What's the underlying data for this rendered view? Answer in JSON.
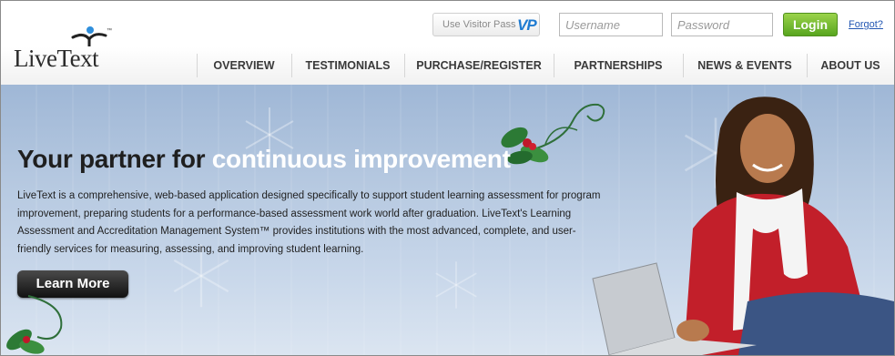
{
  "header": {
    "logo_text": "LiveText",
    "logo_tm": "™",
    "visitor_pass_label": "Use Visitor Pass",
    "visitor_pass_icon": "VP",
    "username_placeholder": "Username",
    "password_placeholder": "Password",
    "login_label": "Login",
    "forgot_label": "Forgot?"
  },
  "nav": {
    "items": [
      {
        "label": "OVERVIEW"
      },
      {
        "label": "TESTIMONIALS"
      },
      {
        "label": "PURCHASE/REGISTER"
      },
      {
        "label": "PARTNERSHIPS"
      },
      {
        "label": "NEWS & EVENTS"
      },
      {
        "label": "ABOUT US"
      }
    ]
  },
  "hero": {
    "headline_dark": "Your partner for",
    "headline_light": "continuous improvement",
    "description": "LiveText is a comprehensive, web-based application designed specifically to support student learning assessment for program improvement, preparing students for a performance-based assessment work world after graduation. LiveText's Learning Assessment and Accreditation Management System™ provides institutions with the most advanced, complete, and user-friendly services for measuring, assessing, and improving student learning.",
    "learn_more_label": "Learn More"
  },
  "colors": {
    "brand_blue": "#1f7bd1",
    "login_green": "#58a51f",
    "link_blue": "#2357b3",
    "hero_sky": "#b5c8e0"
  },
  "icons": [
    "livetext-logo-icon",
    "visitor-pass-icon",
    "holly-icon",
    "snowflake-icon"
  ]
}
